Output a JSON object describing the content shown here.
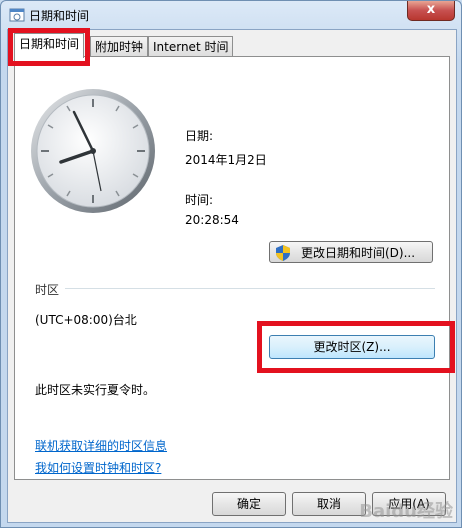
{
  "window": {
    "title": "日期和时间",
    "close_label": "x"
  },
  "tabs": [
    {
      "label": "日期和时间",
      "active": true
    },
    {
      "label": "附加时钟",
      "active": false
    },
    {
      "label": "Internet 时间",
      "active": false
    }
  ],
  "datetime": {
    "date_label": "日期:",
    "date_value": "2014年1月2日",
    "time_label": "时间:",
    "time_value": "20:28:54",
    "change_datetime_button": "更改日期和时间(D)..."
  },
  "timezone": {
    "section_label": "时区",
    "value": "(UTC+08:00)台北",
    "change_timezone_button": "更改时区(Z)...",
    "dst_note": "此时区未实行夏令时。"
  },
  "links": {
    "online_info": "联机获取详细的时区信息",
    "how_to_set": "我如何设置时钟和时区?"
  },
  "footer": {
    "ok": "确定",
    "cancel": "取消",
    "apply": "应用(A)"
  },
  "watermark": "Baidu经验"
}
